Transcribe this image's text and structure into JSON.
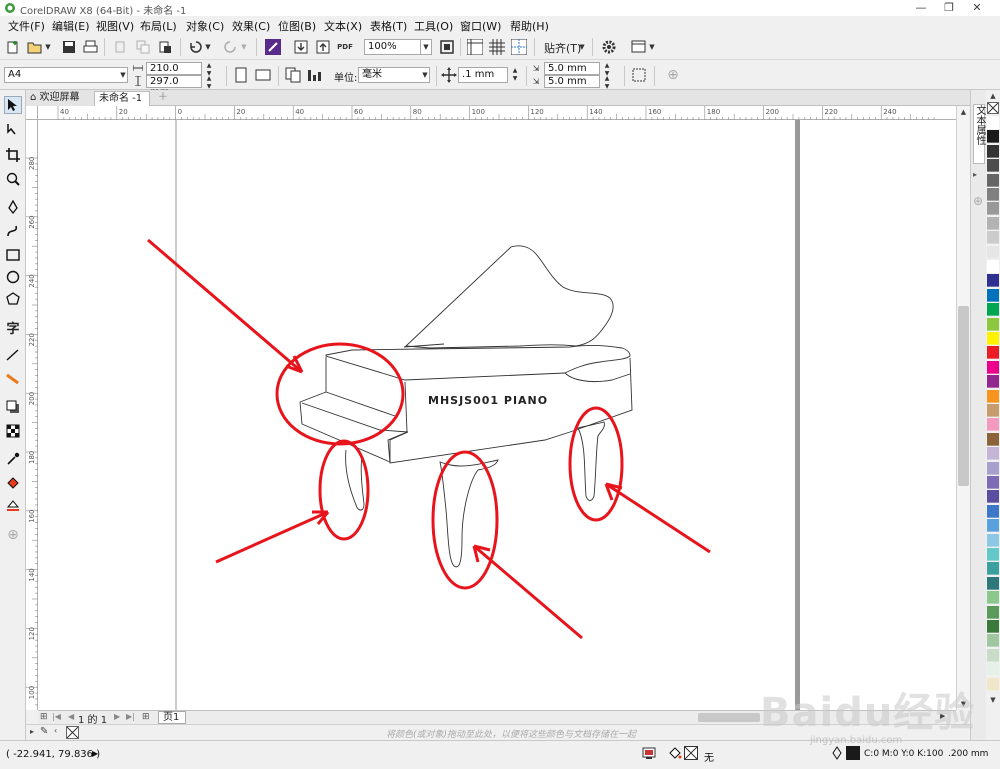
{
  "window": {
    "title": "CorelDRAW X8 (64-Bit) - 未命名 -1",
    "min": "—",
    "restore": "❐",
    "close": "✕"
  },
  "menu": [
    "文件(F)",
    "编辑(E)",
    "视图(V)",
    "布局(L)",
    "对象(C)",
    "效果(C)",
    "位图(B)",
    "文本(X)",
    "表格(T)",
    "工具(O)",
    "窗口(W)",
    "帮助(H)"
  ],
  "toolbar1": {
    "zoom": "100%",
    "snap_label": "贴齐(T)"
  },
  "toolbar2": {
    "page_size": "A4",
    "width": "210.0 mm",
    "height": "297.0 mm",
    "units_label": "单位:",
    "units_value": "毫米",
    "nudge": ".1 mm",
    "dup_x": "5.0 mm",
    "dup_y": "5.0 mm"
  },
  "tabs": [
    {
      "label": "欢迎屏幕"
    },
    {
      "label": "未命名 -1"
    }
  ],
  "hruler_labels": [
    "40",
    "20",
    "0",
    "20",
    "40",
    "60",
    "80",
    "100",
    "120",
    "140",
    "160",
    "180",
    "200",
    "220",
    "240"
  ],
  "vruler_labels": [
    "280",
    "260",
    "240",
    "220",
    "200",
    "180",
    "160",
    "140",
    "120",
    "100",
    "80"
  ],
  "pagebar": {
    "page_info": "1 的 1",
    "page_tab": "页1"
  },
  "colorwell_hint": "将颜色(或对象)拖动至此处，以便将这些颜色与文档存储在一起",
  "docker_label": "文本属性",
  "piano_text": "MHSJS001 PIANO",
  "status": {
    "coords": "( -22.941, 79.836 )",
    "fill_label": "无",
    "outline_color": "C:0 M:0 Y:0 K:100",
    "outline_width": ".200 mm"
  },
  "watermark": {
    "logo": "Baidu经验",
    "url": "jingyan.baidu.com"
  },
  "palette_colors": [
    "#ffffff",
    "#1a1a1a",
    "#333333",
    "#4d4d4d",
    "#666666",
    "#808080",
    "#999999",
    "#b3b3b3",
    "#cccccc",
    "#e6e6e6",
    "#ffffff",
    "#2e3192",
    "#0072bc",
    "#00a651",
    "#8dc63f",
    "#fff200",
    "#ed1c24",
    "#ec008c",
    "#92278f",
    "#f7941d",
    "#c69c6d",
    "#f49ac1",
    "#8c6239",
    "#c4b5d6",
    "#a8a0cc",
    "#7e6bb5",
    "#5b4ea0",
    "#3c78c8",
    "#5aa0dc",
    "#8cc8e6",
    "#64c8c8",
    "#3ca0a0",
    "#2d7878",
    "#8cc88c",
    "#5a9a5a",
    "#3c7a3c",
    "#a0c8a0",
    "#c8dcc8",
    "#e6f0e6",
    "#f0e6c8"
  ],
  "colors": {
    "annotation": "#e8141c",
    "drawing": "#333333",
    "page_shadow": "#999999"
  }
}
